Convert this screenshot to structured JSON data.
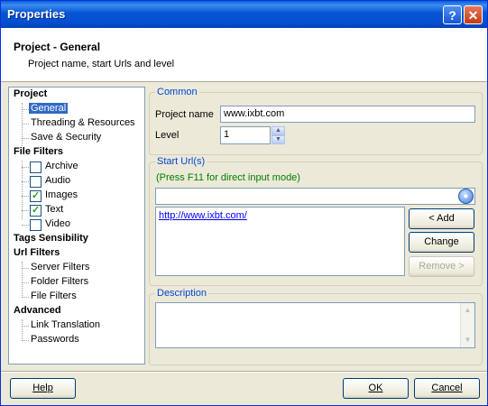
{
  "window": {
    "title": "Properties",
    "help_glyph": "?",
    "close_glyph": "✕"
  },
  "header": {
    "title": "Project - General",
    "subtitle": "Project name, start Urls and level"
  },
  "tree": {
    "nodes": [
      {
        "label": "Project"
      },
      {
        "label": "General"
      },
      {
        "label": "Threading & Resources"
      },
      {
        "label": "Save & Security"
      },
      {
        "label": "File Filters"
      },
      {
        "label": "Archive",
        "checked": false
      },
      {
        "label": "Audio",
        "checked": false
      },
      {
        "label": "Images",
        "checked": true
      },
      {
        "label": "Text",
        "checked": true
      },
      {
        "label": "Video",
        "checked": false
      },
      {
        "label": "Tags Sensibility"
      },
      {
        "label": "Url Filters"
      },
      {
        "label": "Server Filters"
      },
      {
        "label": "Folder Filters"
      },
      {
        "label": "File Filters"
      },
      {
        "label": "Advanced"
      },
      {
        "label": "Link Translation"
      },
      {
        "label": "Passwords"
      }
    ],
    "check_glyph": "✓"
  },
  "common": {
    "title": "Common",
    "project_name_label": "Project name",
    "project_name_value": "www.ixbt.com",
    "level_label": "Level",
    "level_value": "1",
    "spin_up": "▲",
    "spin_down": "▼"
  },
  "start_urls": {
    "title": "Start Url(s)",
    "hint": "(Press F11 for direct input mode)",
    "input_value": "",
    "browse_glyph": "●",
    "items": [
      "http://www.ixbt.com/"
    ],
    "add_label": "< Add",
    "change_label": "Change",
    "remove_label": "Remove >"
  },
  "description": {
    "title": "Description",
    "value": "",
    "scroll_up": "▲",
    "scroll_down": "▼"
  },
  "footer": {
    "help_label": "Help",
    "ok_label": "OK",
    "cancel_label": "Cancel"
  }
}
